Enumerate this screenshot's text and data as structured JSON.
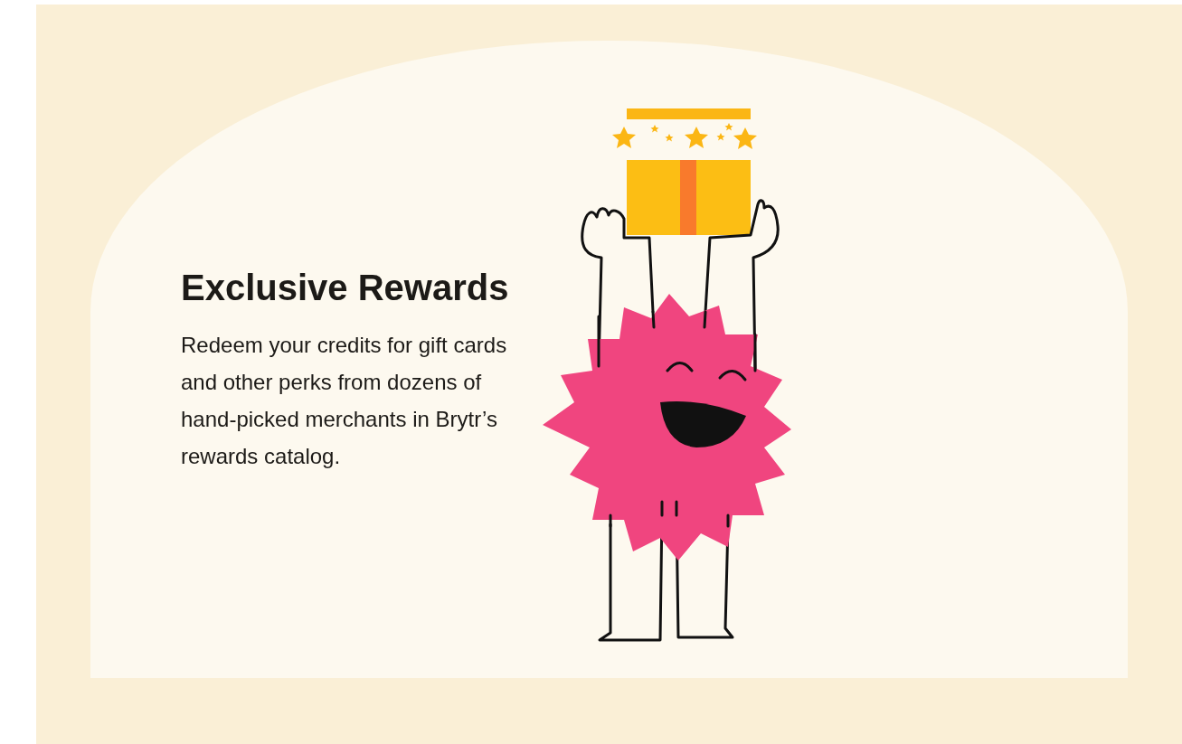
{
  "heading": "Exclusive Rewards",
  "body": "Redeem your credits for gift cards and other perks from dozens of hand-picked merchants in Brytr’s rewards catalog."
}
